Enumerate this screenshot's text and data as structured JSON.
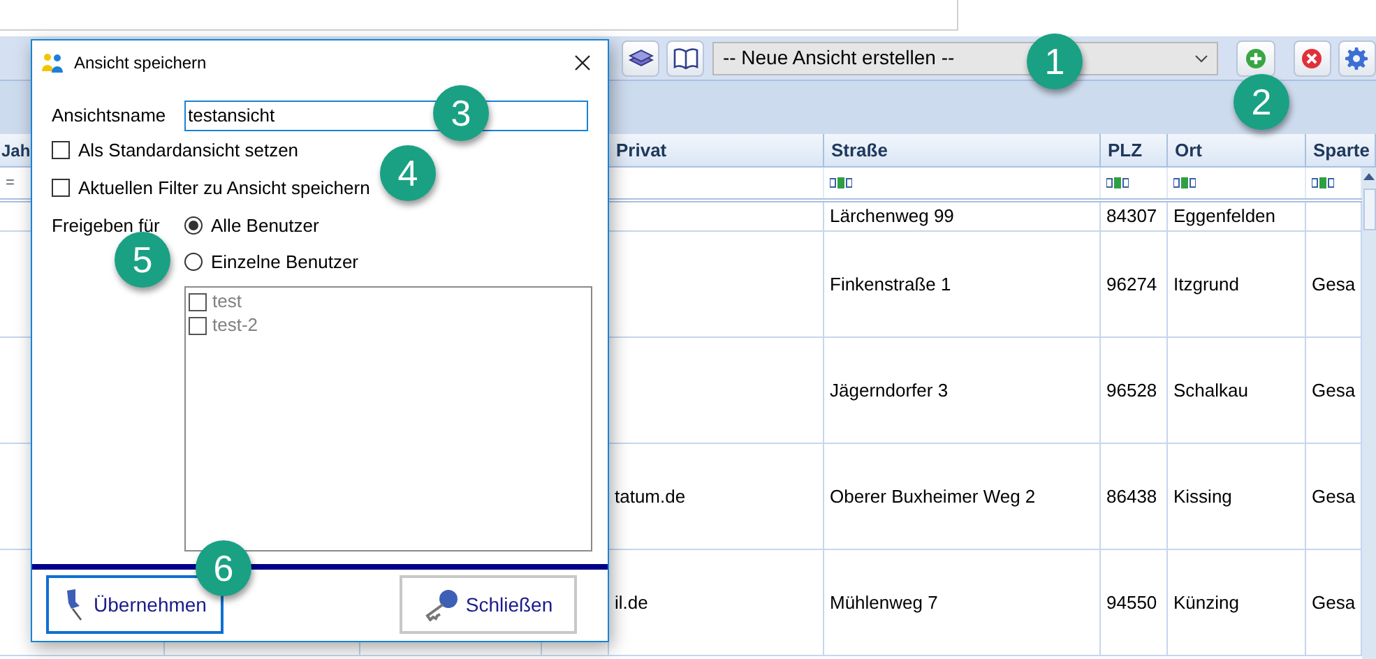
{
  "toolbar": {
    "view_select": {
      "value": "-- Neue Ansicht erstellen --"
    }
  },
  "table": {
    "columns": [
      {
        "label": "Jah"
      },
      {
        "label": "Privat"
      },
      {
        "label": "Straße"
      },
      {
        "label": "PLZ"
      },
      {
        "label": "Ort"
      },
      {
        "label": "Sparte"
      }
    ],
    "filter_operator": "=",
    "rows": [
      {
        "strasse": "Lärchenweg 99",
        "plz": "84307",
        "ort": "Eggenfelden"
      },
      {
        "strasse": "Finkenstraße 1",
        "plz": "96274",
        "ort": "Itzgrund",
        "sparte": "Gesa"
      },
      {
        "strasse": "Jägerndorfer 3",
        "plz": "96528",
        "ort": "Schalkau",
        "sparte": "Gesa"
      },
      {
        "privat": "tatum.de",
        "strasse": "Oberer Buxheimer Weg 2",
        "plz": "86438",
        "ort": "Kissing",
        "sparte": "Gesa"
      },
      {
        "privat": "il.de",
        "strasse": "Mühlenweg 7",
        "plz": "94550",
        "ort": "Künzing",
        "sparte": "Gesa"
      }
    ]
  },
  "dialog": {
    "title": "Ansicht speichern",
    "name_label": "Ansichtsname",
    "name_value": "testansicht",
    "options": [
      {
        "label": "Als Standardansicht setzen",
        "checked": false
      },
      {
        "label": "Aktuellen Filter zu Ansicht speichern",
        "checked": false
      }
    ],
    "share_label": "Freigeben für",
    "share_options": [
      {
        "label": "Alle Benutzer",
        "selected": true
      },
      {
        "label": "Einzelne Benutzer",
        "selected": false
      }
    ],
    "users": [
      {
        "label": "test",
        "checked": false,
        "disabled": true
      },
      {
        "label": "test-2",
        "checked": false,
        "disabled": true
      }
    ],
    "buttons": [
      {
        "kind": "apply",
        "label": "Übernehmen",
        "focused": true
      },
      {
        "kind": "close",
        "label": "Schließen",
        "focused": false
      }
    ]
  },
  "callouts": [
    {
      "label": "1"
    },
    {
      "label": "2"
    },
    {
      "label": "3"
    },
    {
      "label": "4"
    },
    {
      "label": "5"
    },
    {
      "label": "6"
    }
  ]
}
